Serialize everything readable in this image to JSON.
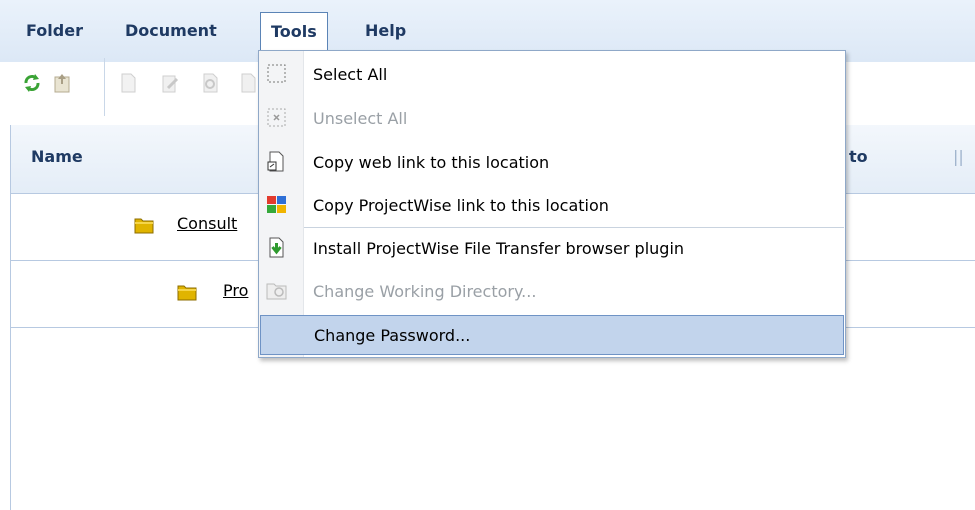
{
  "menubar": {
    "items": [
      {
        "label": "Folder"
      },
      {
        "label": "Document"
      },
      {
        "label": "Tools"
      },
      {
        "label": "Help"
      }
    ]
  },
  "grid": {
    "columns": [
      {
        "label": "Name"
      },
      {
        "label": "to"
      },
      {
        "label": "||"
      }
    ],
    "rows": [
      {
        "name": "Consult"
      },
      {
        "name": "Pro"
      }
    ]
  },
  "tools_menu": {
    "items": [
      {
        "label": "Select All",
        "icon": "select-all-icon",
        "enabled": true
      },
      {
        "label": "Unselect All",
        "icon": "unselect-all-icon",
        "enabled": false
      },
      {
        "label": "Copy web link to this location",
        "icon": "web-link-icon",
        "enabled": true
      },
      {
        "label": "Copy ProjectWise link to this location",
        "icon": "projectwise-link-icon",
        "enabled": true
      },
      {
        "label": "Install ProjectWise File Transfer browser plugin",
        "icon": "install-plugin-icon",
        "enabled": true
      },
      {
        "label": "Change Working Directory...",
        "icon": "working-directory-icon",
        "enabled": false
      },
      {
        "label": "Change Password...",
        "icon": "",
        "enabled": true,
        "highlighted": true
      }
    ]
  },
  "colors": {
    "menu_text": "#1f3a63",
    "highlight": "#c2d4ec",
    "highlight_border": "#6f93c5",
    "disabled_text": "#9aa0a6",
    "folder": "#e0b400"
  }
}
